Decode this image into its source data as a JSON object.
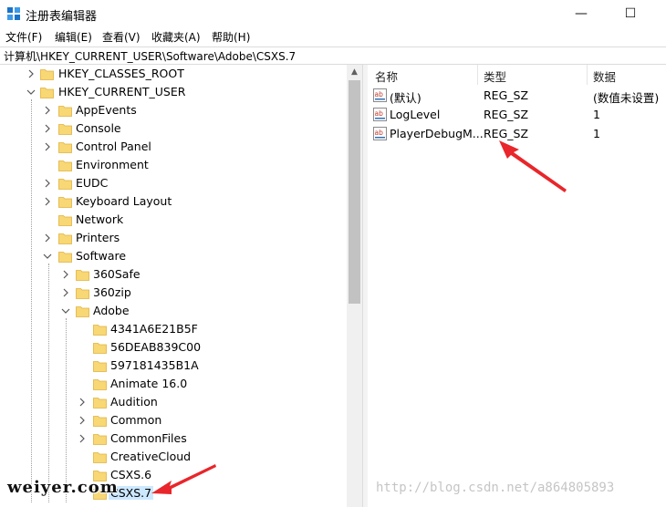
{
  "window": {
    "title": "注册表编辑器",
    "minimize_glyph": "—",
    "maximize_glyph": "☐"
  },
  "menu": [
    "文件(F)",
    "编辑(E)",
    "查看(V)",
    "收藏夹(A)",
    "帮助(H)"
  ],
  "address": "计算机\\HKEY_CURRENT_USER\\Software\\Adobe\\CSXS.7",
  "tree": [
    {
      "label": "HKEY_CLASSES_ROOT",
      "depth": 0,
      "expander": "collapsed",
      "selected": false
    },
    {
      "label": "HKEY_CURRENT_USER",
      "depth": 0,
      "expander": "expanded",
      "selected": false
    },
    {
      "label": "AppEvents",
      "depth": 1,
      "expander": "collapsed",
      "selected": false
    },
    {
      "label": "Console",
      "depth": 1,
      "expander": "collapsed",
      "selected": false
    },
    {
      "label": "Control Panel",
      "depth": 1,
      "expander": "collapsed",
      "selected": false
    },
    {
      "label": "Environment",
      "depth": 1,
      "expander": "none",
      "selected": false
    },
    {
      "label": "EUDC",
      "depth": 1,
      "expander": "collapsed",
      "selected": false
    },
    {
      "label": "Keyboard Layout",
      "depth": 1,
      "expander": "collapsed",
      "selected": false
    },
    {
      "label": "Network",
      "depth": 1,
      "expander": "none",
      "selected": false
    },
    {
      "label": "Printers",
      "depth": 1,
      "expander": "collapsed",
      "selected": false
    },
    {
      "label": "Software",
      "depth": 1,
      "expander": "expanded",
      "selected": false
    },
    {
      "label": "360Safe",
      "depth": 2,
      "expander": "collapsed",
      "selected": false
    },
    {
      "label": "360zip",
      "depth": 2,
      "expander": "collapsed",
      "selected": false
    },
    {
      "label": "Adobe",
      "depth": 2,
      "expander": "expanded",
      "selected": false
    },
    {
      "label": "4341A6E21B5F",
      "depth": 3,
      "expander": "none",
      "selected": false
    },
    {
      "label": "56DEAB839C00",
      "depth": 3,
      "expander": "none",
      "selected": false
    },
    {
      "label": "597181435B1A",
      "depth": 3,
      "expander": "none",
      "selected": false
    },
    {
      "label": "Animate 16.0",
      "depth": 3,
      "expander": "none",
      "selected": false
    },
    {
      "label": "Audition",
      "depth": 3,
      "expander": "collapsed",
      "selected": false
    },
    {
      "label": "Common",
      "depth": 3,
      "expander": "collapsed",
      "selected": false
    },
    {
      "label": "CommonFiles",
      "depth": 3,
      "expander": "collapsed",
      "selected": false
    },
    {
      "label": "CreativeCloud",
      "depth": 3,
      "expander": "none",
      "selected": false
    },
    {
      "label": "CSXS.6",
      "depth": 3,
      "expander": "none",
      "selected": false
    },
    {
      "label": "CSXS.7",
      "depth": 3,
      "expander": "none",
      "selected": true
    }
  ],
  "list": {
    "columns": [
      "名称",
      "类型",
      "数据"
    ],
    "rows": [
      {
        "name": "(默认)",
        "type": "REG_SZ",
        "data": "(数值未设置)"
      },
      {
        "name": "LogLevel",
        "type": "REG_SZ",
        "data": "1"
      },
      {
        "name": "PlayerDebugM...",
        "type": "REG_SZ",
        "data": "1"
      }
    ]
  },
  "colors": {
    "selection": "#cce8ff",
    "folder": "#f8d775",
    "folder_edge": "#e0b23e",
    "arrow": "#e8262b"
  },
  "watermarks": {
    "left": "weiyer.com",
    "right": "http://blog.csdn.net/a864805893"
  }
}
